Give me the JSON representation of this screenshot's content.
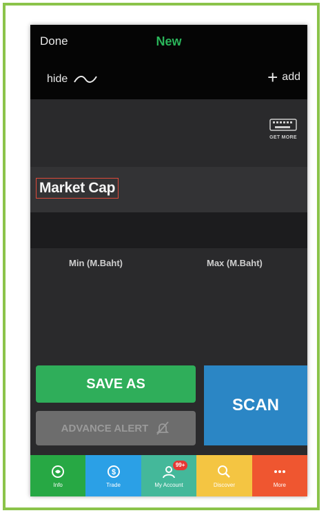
{
  "topbar": {
    "done_label": "Done",
    "title": "New",
    "hide_label": "hide",
    "add_label": "add"
  },
  "keyboard": {
    "label": "GET MORE"
  },
  "filter": {
    "label": "Market Cap",
    "min_label": "Min (M.Baht)",
    "max_label": "Max (M.Baht)"
  },
  "actions": {
    "save_as": "SAVE AS",
    "advance_alert": "ADVANCE ALERT",
    "scan": "SCAN"
  },
  "tabs": [
    {
      "label": "Info",
      "icon": "info-icon",
      "color": "#27a844"
    },
    {
      "label": "Trade",
      "icon": "trade-icon",
      "color": "#2ba0e6"
    },
    {
      "label": "My Account",
      "icon": "account-icon",
      "color": "#44b89a",
      "badge": "99+"
    },
    {
      "label": "Discover",
      "icon": "discover-icon",
      "color": "#f4c542"
    },
    {
      "label": "More",
      "icon": "more-icon",
      "color": "#ef5630"
    }
  ],
  "colors": {
    "accent_green": "#2ab55a",
    "frame_green": "#8bc34a",
    "scan_blue": "#2b86c5"
  }
}
